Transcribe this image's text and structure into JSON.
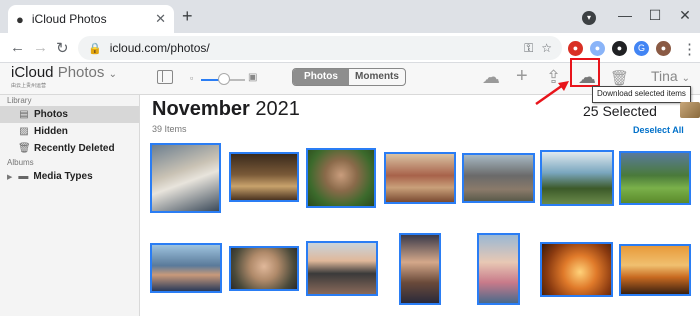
{
  "browser": {
    "tab_title": "iCloud Photos",
    "tab_close": "✕",
    "new_tab": "+",
    "url": "icloud.com/photos/",
    "minimize": "—",
    "maximize": "☐",
    "close": "✕",
    "back": "←",
    "forward": "→",
    "reload": "↻",
    "lock": "🔒",
    "key": "⚿",
    "star": "☆",
    "menu": "⋮"
  },
  "app": {
    "brand_main": "iCloud",
    "brand_sub_word": "Photos",
    "brand_chevron": "⌄",
    "brand_caption": "由云上贵州运营",
    "zoom_small": "▫",
    "zoom_big": "▣",
    "tabs": [
      {
        "label": "Photos",
        "active": true
      },
      {
        "label": "Moments",
        "active": false
      }
    ],
    "upload_icon": "☁",
    "add_icon": "+",
    "share_icon": "⇪",
    "download_icon": "☁",
    "trash_icon": "🗑",
    "user": "Tina",
    "user_chevron": "⌄",
    "tooltip": "Download selected items"
  },
  "sidebar": {
    "library_header": "Library",
    "library_items": [
      {
        "label": "Photos",
        "icon": "photos-icon",
        "active": true
      },
      {
        "label": "Hidden",
        "icon": "hidden-icon",
        "active": false
      },
      {
        "label": "Recently Deleted",
        "icon": "trash-icon",
        "active": false
      }
    ],
    "albums_header": "Albums",
    "album_folder": "Media Types"
  },
  "main": {
    "month": "November",
    "year": "2021",
    "items_count": "39 Items",
    "selected": "25 Selected",
    "deselect_label": "Deselect All"
  },
  "colors": {
    "accent": "#2a7df4",
    "link": "#0070c9",
    "highlight_red": "#e8141b"
  }
}
